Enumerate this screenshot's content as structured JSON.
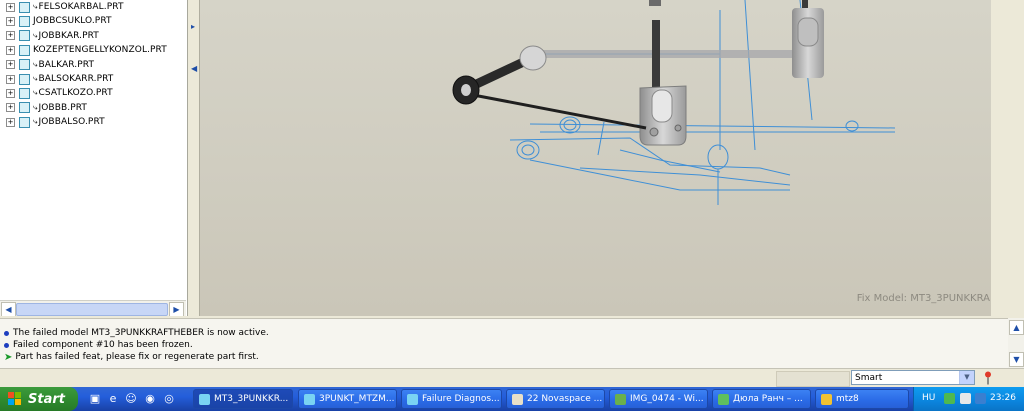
{
  "model_tree": {
    "items": [
      {
        "label": "FELSOKARBAL.PRT",
        "expander": "+",
        "link_icon": true
      },
      {
        "label": "JOBBCSUKLO.PRT",
        "expander": "+",
        "link_icon": false
      },
      {
        "label": "JOBBKAR.PRT",
        "expander": "+",
        "link_icon": true
      },
      {
        "label": "KOZEPTENGELLYKONZOL.PRT",
        "expander": "+",
        "link_icon": false
      },
      {
        "label": "BALKAR.PRT",
        "expander": "+",
        "link_icon": true
      },
      {
        "label": "BALSOKARR.PRT",
        "expander": "+",
        "link_icon": true
      },
      {
        "label": "CSATLKOZO.PRT",
        "expander": "+",
        "link_icon": true
      },
      {
        "label": "JOBBB.PRT",
        "expander": "+",
        "link_icon": true
      },
      {
        "label": "JOBBALSO.PRT",
        "expander": "+",
        "link_icon": true
      }
    ],
    "link_glyph": "⤷"
  },
  "viewport": {
    "fix_model_label": "Fix Model: MT3_3PUNKKRA"
  },
  "messages": [
    {
      "type": "info",
      "text": "The failed model MT3_3PUNKKRAFTHEBER is now active."
    },
    {
      "type": "info",
      "text": "Failed component #10 has been frozen."
    },
    {
      "type": "arrow",
      "text": "Part has failed feat, please fix or regenerate part first."
    }
  ],
  "status_bar": {
    "filter_value": "Smart",
    "dropdown_glyph": "▼"
  },
  "taskbar": {
    "start_label": "Start",
    "tasks": [
      {
        "label": "MT3_3PUNKKR...",
        "active": true,
        "icon": "proe-icon",
        "color": "#79d3f3"
      },
      {
        "label": "3PUNKT_MTZM...",
        "active": false,
        "icon": "proe-icon",
        "color": "#79d3f3"
      },
      {
        "label": "Failure Diagnos...",
        "active": false,
        "icon": "proe-icon",
        "color": "#79d3f3"
      },
      {
        "label": "22 Novaspace ...",
        "active": false,
        "icon": "mask-icon",
        "color": "#e8e0c8"
      },
      {
        "label": "IMG_0474 - Wi...",
        "active": false,
        "icon": "image-viewer-icon",
        "color": "#6ab04c"
      },
      {
        "label": "Дюла Ранч – ...",
        "active": false,
        "icon": "messenger-icon",
        "color": "#5fbf5f"
      },
      {
        "label": "mtz8",
        "active": false,
        "icon": "folder-icon",
        "color": "#f1c232"
      }
    ],
    "language": "HU",
    "clock": "23:26"
  },
  "colors": {
    "taskbar_blue": "#245edb",
    "start_green": "#2f8b2f",
    "tray_blue": "#0b84dd",
    "wireframe_blue": "#3f8fd6",
    "message_dot": "#1e3fbf"
  }
}
